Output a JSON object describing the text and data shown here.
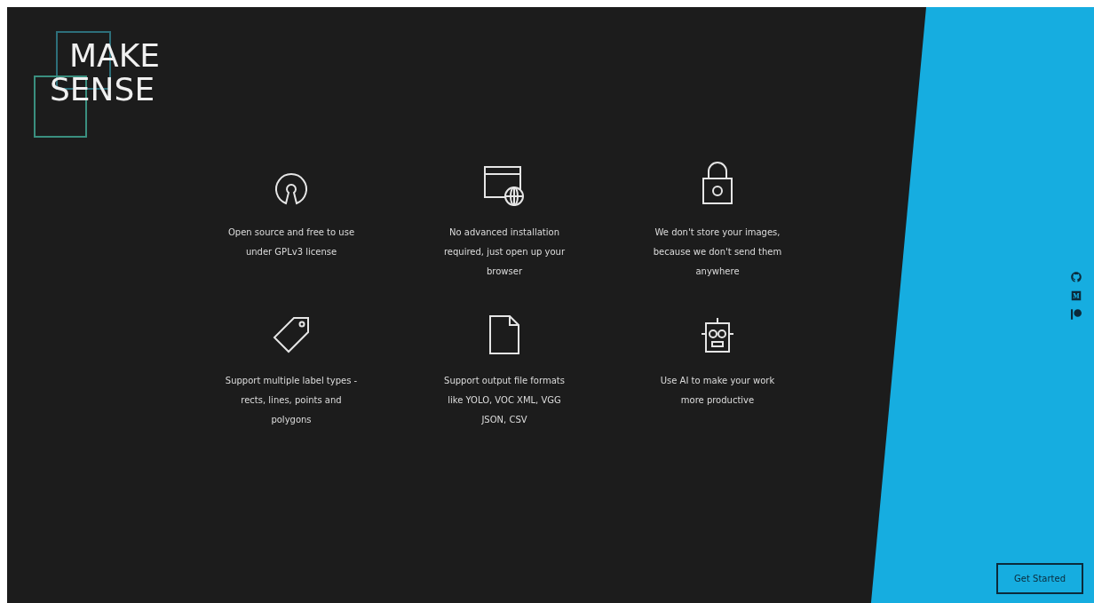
{
  "logo": {
    "lines": [
      "MAKE",
      "SENSE"
    ]
  },
  "features": [
    {
      "kind": "open-source",
      "text": "Open source and free to use under GPLv3 license"
    },
    {
      "kind": "browser",
      "text": "No advanced installation required, just open up your browser"
    },
    {
      "kind": "lock",
      "text": "We don't store your images, because we don't send them anywhere"
    },
    {
      "kind": "tag",
      "text": "Support multiple label types - rects, lines, points and polygons"
    },
    {
      "kind": "file",
      "text": "Support output file formats like YOLO, VOC XML, VGG JSON, CSV"
    },
    {
      "kind": "robot",
      "text": "Use AI to make your work more productive"
    }
  ],
  "social_links": [
    {
      "kind": "octocat"
    },
    {
      "kind": "m-logo"
    },
    {
      "kind": "p-logo"
    }
  ],
  "get_started_button": "Get Started"
}
